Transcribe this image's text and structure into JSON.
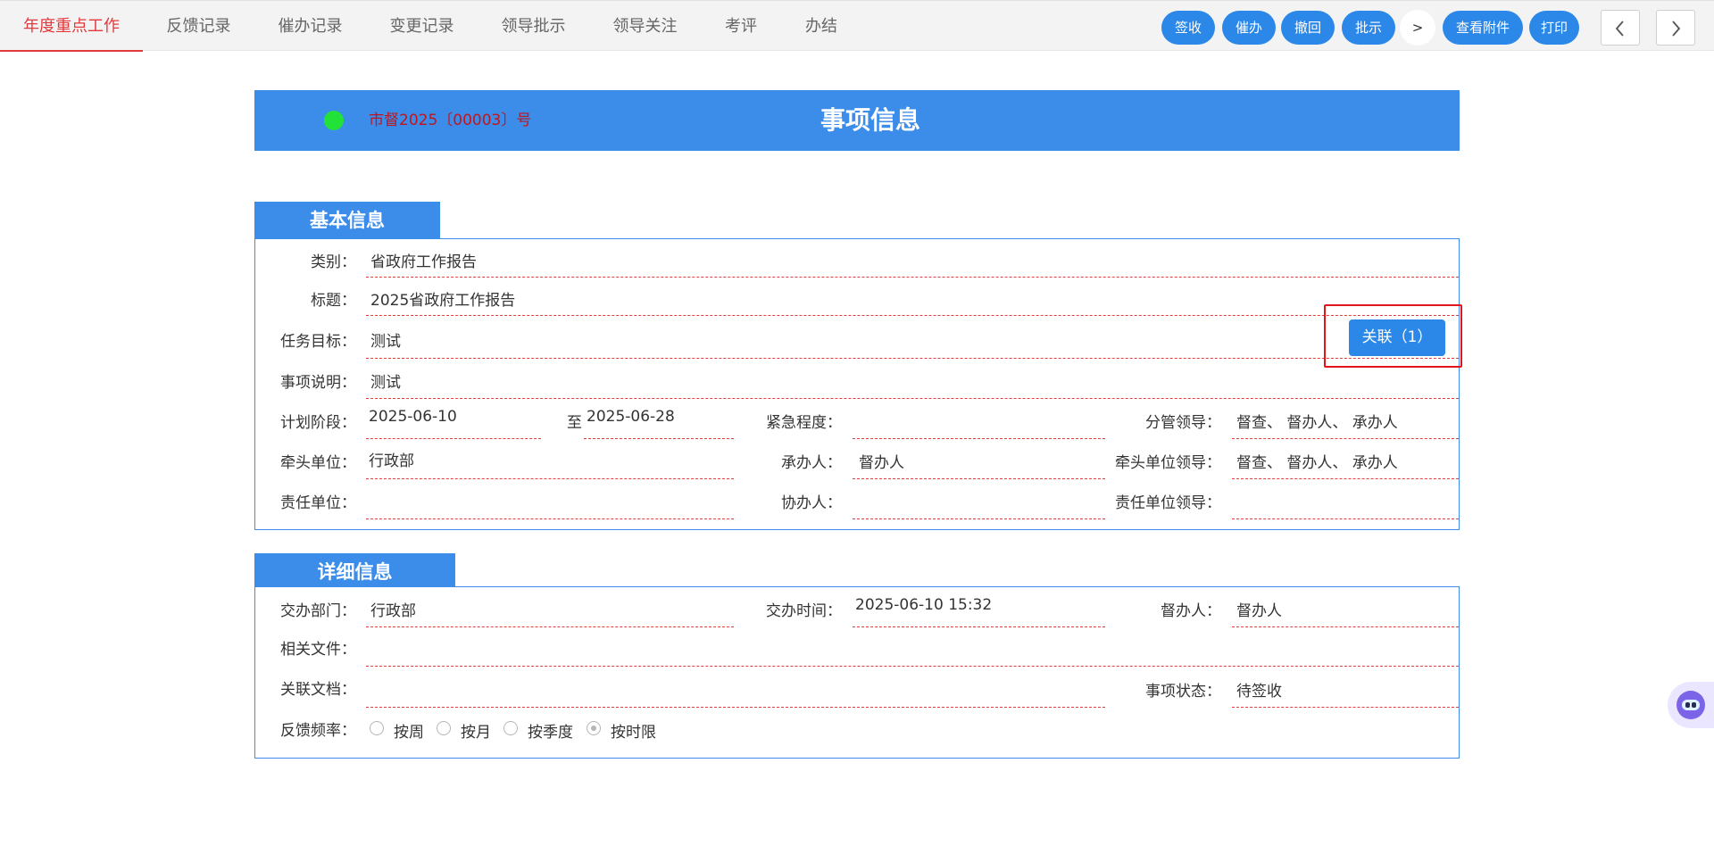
{
  "tabs": [
    {
      "label": "年度重点工作",
      "active": true
    },
    {
      "label": "反馈记录"
    },
    {
      "label": "催办记录"
    },
    {
      "label": "变更记录"
    },
    {
      "label": "领导批示"
    },
    {
      "label": "领导关注"
    },
    {
      "label": "考评"
    },
    {
      "label": "办结"
    }
  ],
  "actions": {
    "sign": "签收",
    "urge": "催办",
    "withdraw": "撤回",
    "instruct": "批示",
    "more": ">",
    "attachments": "查看附件",
    "print": "打印"
  },
  "banner": {
    "doc_number": "市督2025〔00003〕号",
    "title": "事项信息",
    "status_color": "#22e23a"
  },
  "basic": {
    "heading": "基本信息",
    "category_label": "类别：",
    "category": "省政府工作报告",
    "title_label": "标题：",
    "title": "2025省政府工作报告",
    "goal_label": "任务目标：",
    "goal": "测试",
    "desc_label": "事项说明：",
    "desc": "测试",
    "link_button": "关联（1）",
    "plan_label": "计划阶段：",
    "plan_start": "2025-06-10",
    "plan_to": "至",
    "plan_end": "2025-06-28",
    "urgency_label": "紧急程度：",
    "urgency": "",
    "leader_label": "分管领导：",
    "leader": "督查、 督办人、 承办人",
    "lead_unit_label": "牵头单位：",
    "lead_unit": "行政部",
    "handler_label": "承办人：",
    "handler": "督办人",
    "lead_unit_leader_label": "牵头单位领导：",
    "lead_unit_leader": "督查、 督办人、 承办人",
    "resp_unit_label": "责任单位：",
    "resp_unit": "",
    "co_handler_label": "协办人：",
    "co_handler": "",
    "resp_unit_leader_label": "责任单位领导：",
    "resp_unit_leader": ""
  },
  "detail": {
    "heading": "详细信息",
    "dept_label": "交办部门：",
    "dept": "行政部",
    "time_label": "交办时间：",
    "time": "2025-06-10 15:32",
    "supervisor_label": "督办人：",
    "supervisor": "督办人",
    "files_label": "相关文件：",
    "files": "",
    "docs_label": "关联文档：",
    "docs": "",
    "state_label": "事项状态：",
    "state": "待签收",
    "freq_label": "反馈频率：",
    "freq_options": [
      "按周",
      "按月",
      "按季度",
      "按时限"
    ],
    "freq_selected": "按时限"
  }
}
